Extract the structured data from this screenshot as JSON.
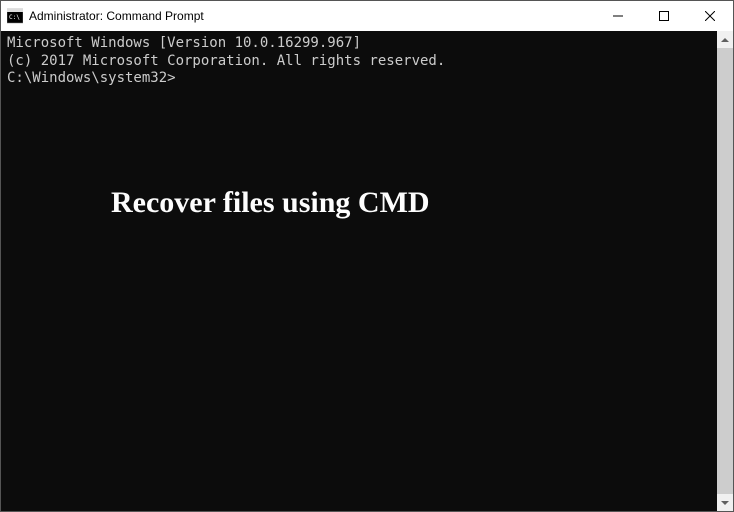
{
  "window": {
    "title": "Administrator: Command Prompt"
  },
  "terminal": {
    "line1": "Microsoft Windows [Version 10.0.16299.967]",
    "line2": "(c) 2017 Microsoft Corporation. All rights reserved.",
    "blank": "",
    "prompt": "C:\\Windows\\system32>"
  },
  "overlay": {
    "text": "Recover files using CMD"
  }
}
